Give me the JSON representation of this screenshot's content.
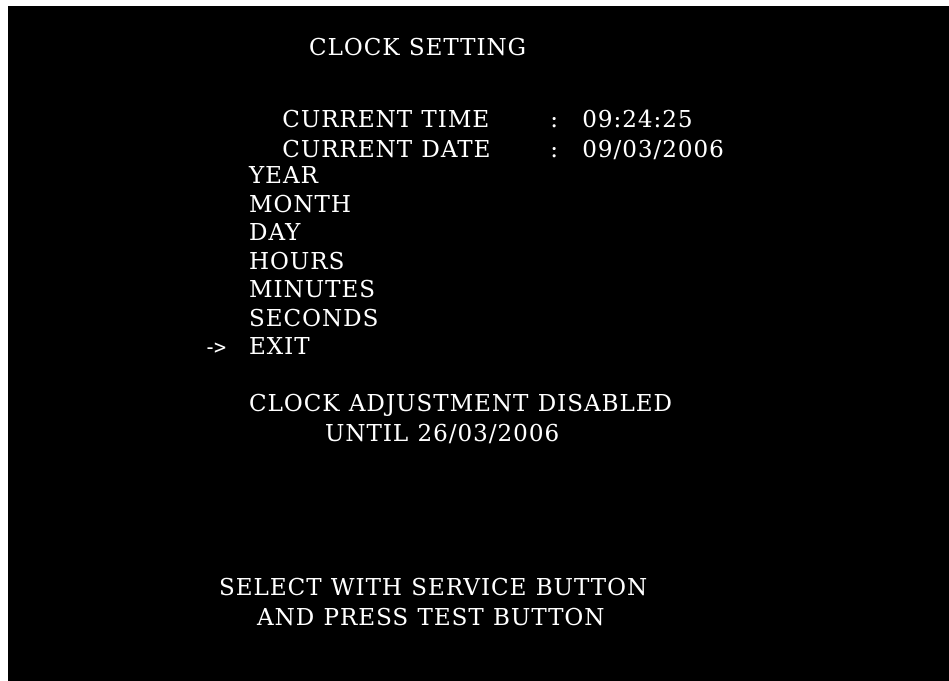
{
  "screen": {
    "title": "CLOCK SETTING",
    "current_time": {
      "label": "CURRENT TIME",
      "separator": ":",
      "value": "09:24:25"
    },
    "current_date": {
      "label": "CURRENT DATE",
      "separator": ":",
      "value": "09/03/2006"
    },
    "menu": [
      {
        "label": "YEAR"
      },
      {
        "label": "MONTH"
      },
      {
        "label": "DAY"
      },
      {
        "label": "HOURS"
      },
      {
        "label": "MINUTES"
      },
      {
        "label": "SECONDS"
      },
      {
        "label": "EXIT",
        "selected": true
      }
    ],
    "cursor_glyph": "->",
    "status_line1": "CLOCK ADJUSTMENT DISABLED",
    "status_line2": "UNTIL 26/03/2006",
    "footer_line1": "SELECT WITH SERVICE BUTTON",
    "footer_line2": "AND PRESS TEST BUTTON"
  },
  "colors": {
    "background": "#000000",
    "text": "#ffffff",
    "frame": "#ffffff"
  }
}
